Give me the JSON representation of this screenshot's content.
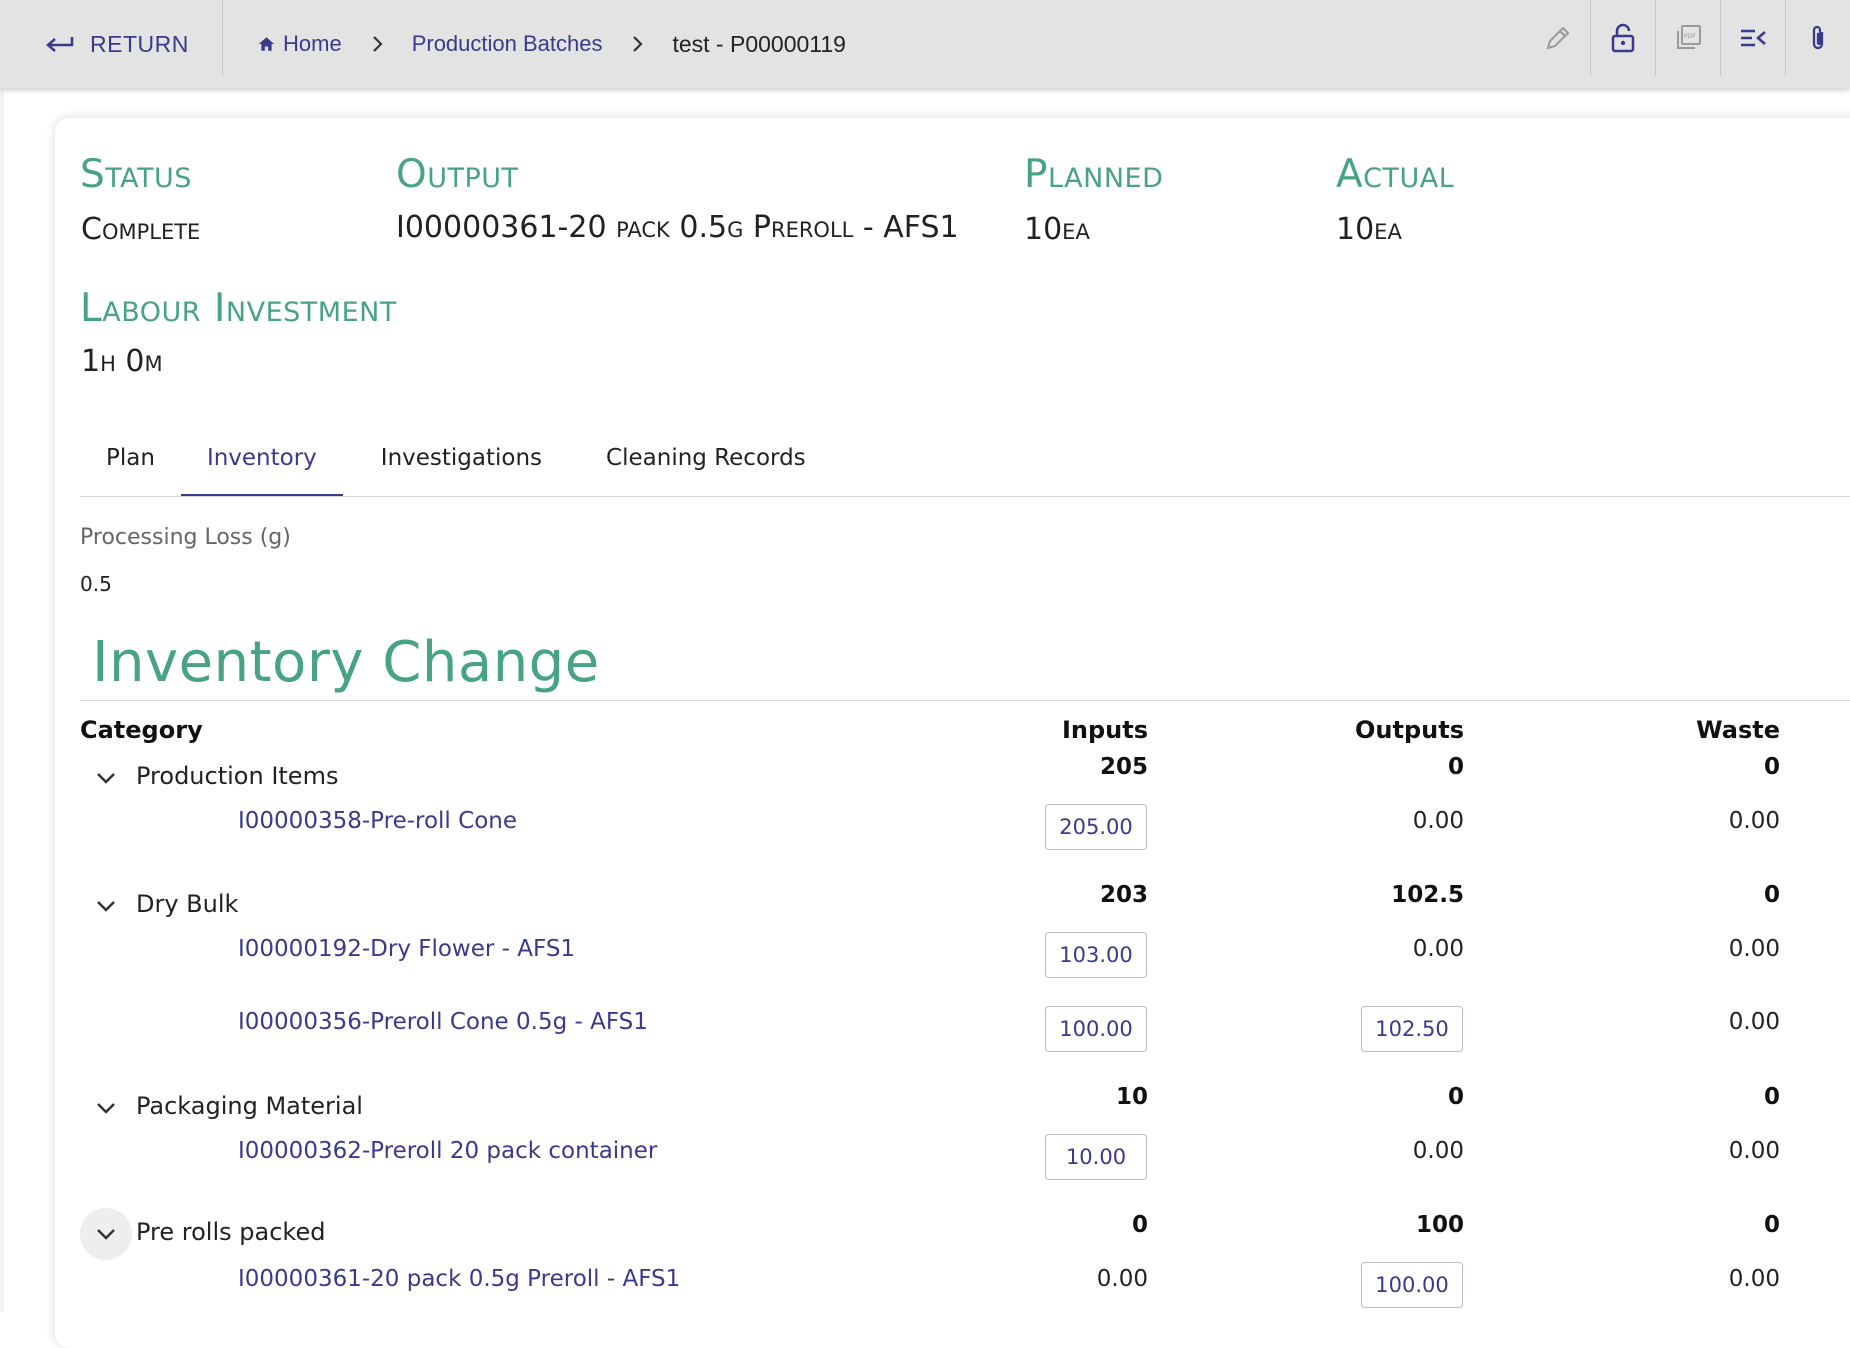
{
  "topbar": {
    "return_label": "RETURN",
    "breadcrumb": {
      "home": "Home",
      "section": "Production Batches",
      "current": "test - P00000119"
    },
    "tools": [
      "pencil-icon",
      "lock-open-icon",
      "pdf-icon",
      "list-collapse-icon",
      "paperclip-icon"
    ]
  },
  "summary": {
    "status_label": "Status",
    "status_value": "Complete",
    "output_label": "Output",
    "output_value": "I00000361-20 pack 0.5g Preroll - AFS1",
    "planned_label": "Planned",
    "planned_value": "10ea",
    "actual_label": "Actual",
    "actual_value": "10ea",
    "labour_label": "Labour Investment",
    "labour_value": "1h 0m"
  },
  "tabs": [
    "Plan",
    "Inventory",
    "Investigations",
    "Cleaning Records"
  ],
  "active_tab": "Inventory",
  "processing_loss": {
    "label": "Processing Loss (g)",
    "value": "0.5"
  },
  "inventory_change": {
    "title": "Inventory Change",
    "columns": {
      "category": "Category",
      "inputs": "Inputs",
      "outputs": "Outputs",
      "waste": "Waste"
    },
    "categories": [
      {
        "name": "Production Items",
        "inputs": "205",
        "outputs": "0",
        "waste": "0",
        "items": [
          {
            "name": "I00000358-Pre-roll Cone",
            "inputs": "205.00",
            "outputs": "0.00",
            "waste": "0.00"
          }
        ]
      },
      {
        "name": "Dry Bulk",
        "inputs": "203",
        "outputs": "102.5",
        "waste": "0",
        "items": [
          {
            "name": "I00000192-Dry Flower - AFS1",
            "inputs": "103.00",
            "outputs": "0.00",
            "waste": "0.00"
          },
          {
            "name": "I00000356-Preroll Cone 0.5g - AFS1",
            "inputs": "100.00",
            "outputs": "102.50",
            "waste": "0.00"
          }
        ]
      },
      {
        "name": "Packaging Material",
        "inputs": "10",
        "outputs": "0",
        "waste": "0",
        "items": [
          {
            "name": "I00000362-Preroll 20 pack container",
            "inputs": "10.00",
            "outputs": "0.00",
            "waste": "0.00"
          }
        ]
      },
      {
        "name": "Pre rolls packed",
        "inputs": "0",
        "outputs": "100",
        "waste": "0",
        "items": [
          {
            "name": "I00000361-20 pack 0.5g Preroll - AFS1",
            "inputs": "0.00",
            "outputs": "100.00",
            "waste": "0.00"
          }
        ]
      }
    ]
  },
  "colors": {
    "accent_green": "#47a384",
    "link_purple": "#3a3a8c",
    "topbar_bg": "#e3e3e3"
  }
}
